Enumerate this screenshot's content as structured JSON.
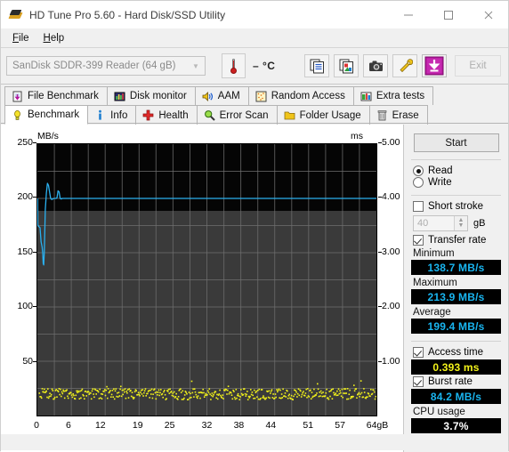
{
  "window": {
    "title": "HD Tune Pro 5.60 - Hard Disk/SSD Utility",
    "icon": "hdtune-logo-icon",
    "minimize": "minimize-icon",
    "maximize": "maximize-icon",
    "close": "close-icon"
  },
  "menu": {
    "items": [
      {
        "label": "File",
        "accel": "F"
      },
      {
        "label": "Help",
        "accel": "H"
      }
    ]
  },
  "toolbar": {
    "drive_selected": "SanDisk SDDR-399 Reader (64 gB)",
    "temperature": "– °C",
    "buttons": [
      {
        "name": "copy-text-button",
        "icon": "copy-text-icon"
      },
      {
        "name": "copy-image-button",
        "icon": "copy-image-icon"
      },
      {
        "name": "screenshot-button",
        "icon": "camera-icon"
      },
      {
        "name": "tools-button",
        "icon": "wrench-icon"
      },
      {
        "name": "save-button",
        "icon": "download-arrow-icon"
      }
    ],
    "exit_label": "Exit"
  },
  "tabs_row1": [
    {
      "label": "File Benchmark",
      "icon": "file-benchmark-icon",
      "active": false
    },
    {
      "label": "Disk monitor",
      "icon": "disk-monitor-icon",
      "active": false
    },
    {
      "label": "AAM",
      "icon": "speaker-icon",
      "active": false
    },
    {
      "label": "Random Access",
      "icon": "random-access-icon",
      "active": false
    },
    {
      "label": "Extra tests",
      "icon": "extra-tests-icon",
      "active": false
    }
  ],
  "tabs_row2": [
    {
      "label": "Benchmark",
      "icon": "lightbulb-icon",
      "active": true
    },
    {
      "label": "Info",
      "icon": "info-icon",
      "active": false
    },
    {
      "label": "Health",
      "icon": "health-cross-icon",
      "active": false
    },
    {
      "label": "Error Scan",
      "icon": "magnifier-icon",
      "active": false
    },
    {
      "label": "Folder Usage",
      "icon": "folder-icon",
      "active": false
    },
    {
      "label": "Erase",
      "icon": "trash-icon",
      "active": false
    }
  ],
  "panel": {
    "start_label": "Start",
    "mode_read": "Read",
    "mode_write": "Write",
    "mode_selected": "Read",
    "short_stroke_label": "Short stroke",
    "short_stroke_checked": false,
    "short_stroke_value": "40",
    "short_stroke_unit": "gB",
    "transfer_rate_label": "Transfer rate",
    "transfer_rate_checked": true,
    "minimum_label": "Minimum",
    "minimum_value": "138.7 MB/s",
    "maximum_label": "Maximum",
    "maximum_value": "213.9 MB/s",
    "average_label": "Average",
    "average_value": "199.4 MB/s",
    "access_time_label": "Access time",
    "access_time_checked": true,
    "access_time_value": "0.393 ms",
    "burst_rate_label": "Burst rate",
    "burst_rate_checked": true,
    "burst_rate_value": "84.2 MB/s",
    "cpu_usage_label": "CPU usage",
    "cpu_usage_value": "3.7%"
  },
  "colors": {
    "transfer_line": "#2ab0ef",
    "access_dots": "#f2f21a",
    "plot_bg": "#3a3a3a",
    "plot_top_band": "#050505",
    "grid": "#6f6f6f"
  },
  "chart_data": {
    "type": "line",
    "title": "",
    "ylabel": "MB/s",
    "ylabel_right": "ms",
    "xlabel": "",
    "ylim": [
      0,
      250
    ],
    "ylim_right": [
      0,
      5.0
    ],
    "xlim": [
      0,
      64
    ],
    "grid": true,
    "legend": "none",
    "yticks": [
      250,
      200,
      150,
      100,
      50
    ],
    "yticks_right": [
      "5.00",
      "4.00",
      "3.00",
      "2.00",
      "1.00"
    ],
    "xticks": [
      "0",
      "6",
      "12",
      "19",
      "25",
      "32",
      "38",
      "44",
      "51",
      "57",
      "64gB"
    ],
    "xtick_values": [
      0,
      6,
      12,
      19,
      25,
      32,
      38,
      44,
      51,
      57,
      64
    ],
    "series": [
      {
        "name": "Transfer rate",
        "color": "#2ab0ef",
        "axis": "left",
        "unit": "MB/s",
        "x": [
          0.1,
          0.3,
          0.5,
          0.7,
          0.9,
          1.0,
          1.1,
          1.2,
          1.3,
          1.5,
          1.7,
          1.9,
          2.1,
          2.3,
          2.5,
          2.7,
          2.9,
          3.1,
          3.3,
          3.5,
          3.7,
          3.9,
          4.1,
          4.3,
          4.5,
          4.7,
          4.9,
          5.1,
          5.3,
          5.6,
          6.0,
          8,
          12,
          16,
          20,
          24,
          28,
          32,
          36,
          40,
          44,
          48,
          52,
          56,
          60,
          64
        ],
        "y": [
          175,
          174,
          173,
          160,
          155,
          150,
          140,
          138.7,
          150,
          190,
          205,
          213.9,
          212,
          206,
          200,
          199,
          199.5,
          200,
          200,
          200,
          200.5,
          207,
          206,
          200,
          199.5,
          200,
          200,
          200,
          200,
          200,
          200,
          200,
          200,
          200,
          200,
          200,
          200,
          200,
          200,
          200,
          200,
          200,
          200,
          200,
          200,
          200
        ]
      },
      {
        "name": "Access time",
        "color": "#f2f21a",
        "axis": "right",
        "unit": "ms",
        "mean": 0.393,
        "scatter_range": [
          0.28,
          0.52
        ],
        "point_count": 480
      }
    ]
  }
}
